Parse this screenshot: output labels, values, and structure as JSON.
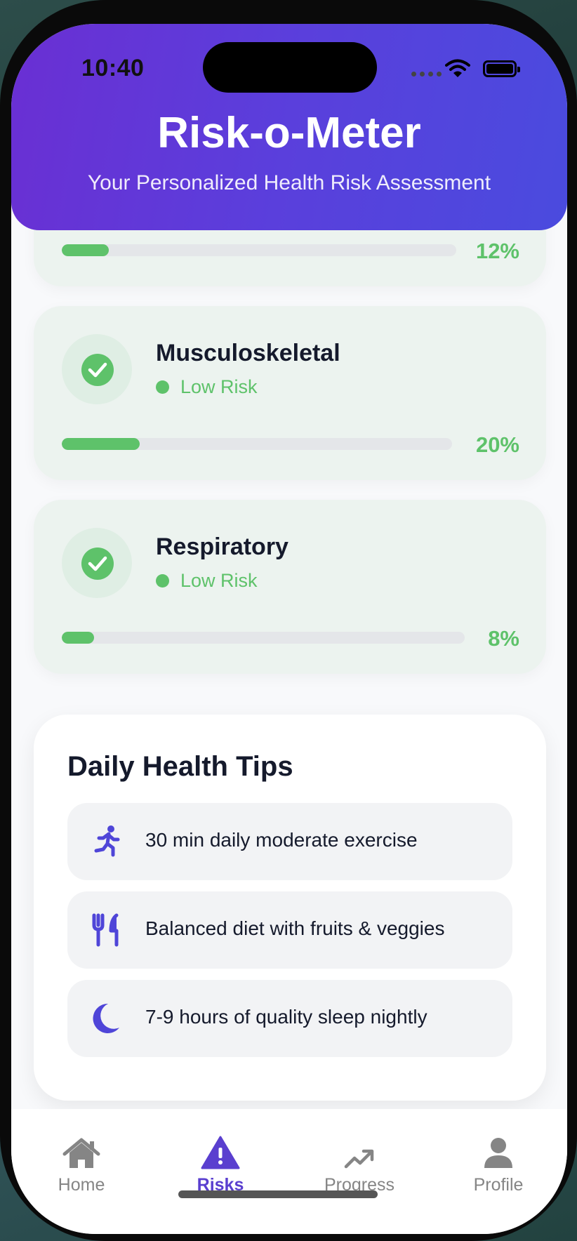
{
  "status_bar": {
    "time": "10:40"
  },
  "header": {
    "title": "Risk-o-Meter",
    "subtitle": "Your Personalized Health Risk Assessment"
  },
  "risks": [
    {
      "name": "",
      "level": "",
      "percent_label": "12%",
      "percent": 12
    },
    {
      "name": "Musculoskeletal",
      "level": "Low Risk",
      "percent_label": "20%",
      "percent": 20
    },
    {
      "name": "Respiratory",
      "level": "Low Risk",
      "percent_label": "8%",
      "percent": 8
    }
  ],
  "tips": {
    "title": "Daily Health Tips",
    "items": [
      {
        "icon": "running-icon",
        "text": "30 min daily moderate exercise"
      },
      {
        "icon": "utensils-icon",
        "text": "Balanced diet with fruits & veggies"
      },
      {
        "icon": "moon-icon",
        "text": "7-9 hours of quality sleep nightly"
      }
    ]
  },
  "nav": {
    "items": [
      {
        "icon": "home-icon",
        "label": "Home",
        "active": false
      },
      {
        "icon": "warning-icon",
        "label": "Risks",
        "active": true
      },
      {
        "icon": "trend-up-icon",
        "label": "Progress",
        "active": false
      },
      {
        "icon": "user-icon",
        "label": "Profile",
        "active": false
      }
    ]
  },
  "colors": {
    "header_gradient_start": "#6a2fd3",
    "header_gradient_end": "#4a4bde",
    "low_risk": "#5ec26a",
    "accent": "#5a3fcf",
    "tip_icon": "#4f45d8"
  }
}
